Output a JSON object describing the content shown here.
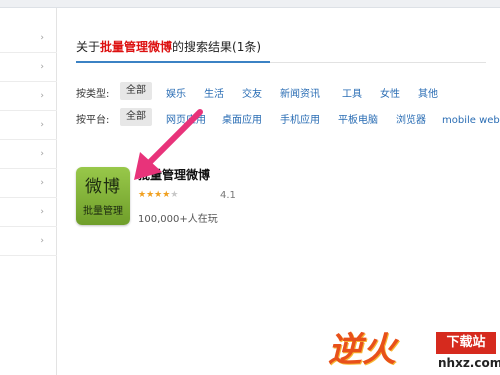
{
  "title": {
    "prefix": "关于",
    "keyword": "批量管理微博",
    "suffix": "的搜索结果(1条)"
  },
  "filters": {
    "type": {
      "label": "按类型:",
      "selected": "全部",
      "options": [
        "娱乐",
        "生活",
        "交友",
        "新闻资讯",
        "工具",
        "女性",
        "其他"
      ]
    },
    "platform": {
      "label": "按平台:",
      "selected": "全部",
      "options": [
        "网页应用",
        "桌面应用",
        "手机应用",
        "平板电脑",
        "浏览器",
        "mobile web手"
      ]
    }
  },
  "result": {
    "icon_line1": "微博",
    "icon_line2": "批量管理",
    "name": "批量管理微博",
    "rating": "4.1",
    "rating_value": 4.1,
    "rating_max": 5,
    "players": "100,000+人在玩"
  },
  "sidebar": {
    "item_count": 8,
    "chevron": "›"
  },
  "annotation": {
    "arrow_color": "#e8337a",
    "icon": "pointer-arrow-icon"
  },
  "watermark": {
    "brand": "逆火",
    "box": "下载站",
    "url": "nhxz.com"
  },
  "colors": {
    "keyword": "#dd1111",
    "link": "#2a6db4",
    "accent": "#3b82c4"
  }
}
